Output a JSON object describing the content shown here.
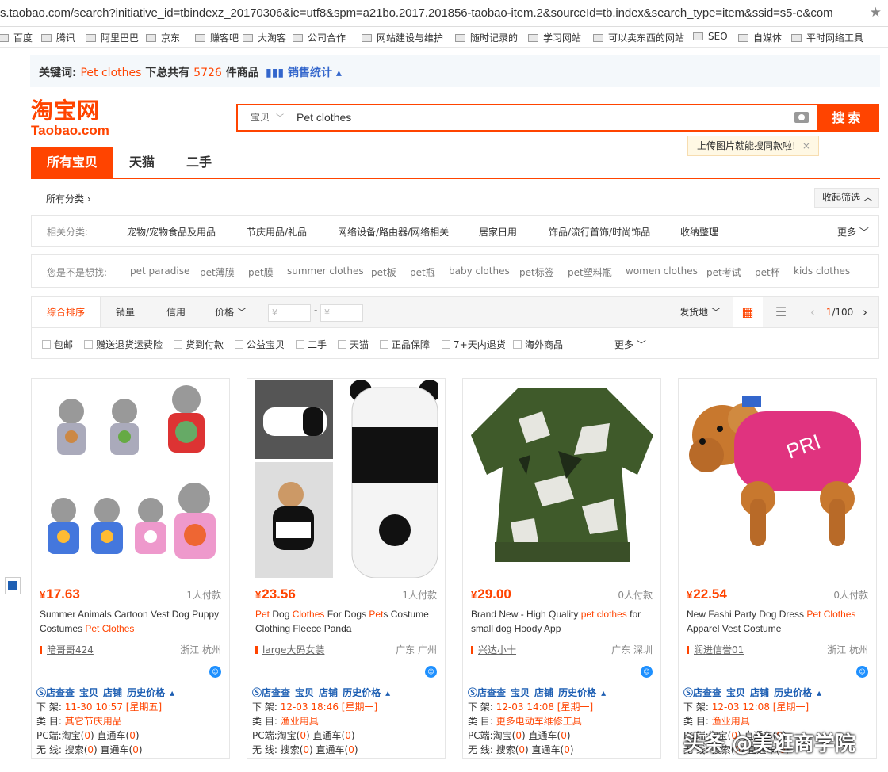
{
  "browser": {
    "url": "s.taobao.com/search?initiative_id=tbindexz_20170306&ie=utf8&spm=a21bo.2017.201856-taobao-item.2&sourceId=tb.index&search_type=item&ssid=s5-e&com",
    "bookmarks": [
      "百度",
      "腾讯",
      "阿里巴巴",
      "京东",
      "赚客吧",
      "大淘客",
      "公司合作",
      "网站建设与维护",
      "随时记录的",
      "学习网站",
      "可以卖东西的网站",
      "SEO",
      "自媒体",
      "平时网络工具"
    ]
  },
  "keyword_bar": {
    "label": "关键词:",
    "keyword": "Pet clothes",
    "mid": "下总共有",
    "count": "5726",
    "suffix": "件商品",
    "sales_stats": "销售统计"
  },
  "logo": {
    "cn": "淘宝网",
    "en": "Taobao.com"
  },
  "search": {
    "category": "宝贝",
    "query": "Pet clothes",
    "button": "搜索",
    "tip": "上传图片就能搜同款啦!"
  },
  "tabs": [
    "所有宝贝",
    "天猫",
    "二手"
  ],
  "all_categories": "所有分类",
  "collapse_filter": "收起筛选",
  "related": {
    "label": "相关分类:",
    "items": [
      "宠物/宠物食品及用品",
      "节庆用品/礼品",
      "网络设备/路由器/网络相关",
      "居家日用",
      "饰品/流行首饰/时尚饰品",
      "收纳整理"
    ],
    "more": "更多"
  },
  "suggest": {
    "label": "您是不是想找:",
    "items": [
      "pet paradise",
      "pet薄膜",
      "pet膜",
      "summer clothes",
      "pet板",
      "pet瓶",
      "baby clothes",
      "pet标签",
      "pet塑料瓶",
      "women clothes",
      "pet考试",
      "pet杯",
      "kids clothes"
    ]
  },
  "sort": {
    "tabs": [
      "综合排序",
      "销量",
      "信用",
      "价格"
    ],
    "price_from": "¥",
    "price_to": "¥",
    "ship_from": "发货地",
    "page": "1",
    "total": "/100"
  },
  "filters": [
    "包邮",
    "赠送退货运费险",
    "货到付款",
    "公益宝贝",
    "二手",
    "天猫",
    "正品保障",
    "7+天内退货",
    "海外商品"
  ],
  "filters_more": "更多",
  "products": [
    {
      "price": "17.63",
      "deals": "1人付款",
      "title_parts": [
        [
          "Summer Animals Cartoon Vest Dog Puppy Costumes ",
          false
        ],
        [
          "Pet Clothes",
          true
        ]
      ],
      "shop": "暗哥哥424",
      "loc": "浙江 杭州",
      "delist_time": "11-30 10:57 [星期五]",
      "category": "其它节庆用品"
    },
    {
      "price": "23.56",
      "deals": "1人付款",
      "title_parts": [
        [
          "Pet",
          true
        ],
        [
          " Dog ",
          false
        ],
        [
          "Clothes",
          true
        ],
        [
          " For Dogs ",
          false
        ],
        [
          "Pet",
          true
        ],
        [
          "s Costume Clothing Fleece Panda",
          false
        ]
      ],
      "shop": "large大码女装",
      "loc": "广东 广州",
      "delist_time": "12-03 18:46 [星期一]",
      "category": "渔业用具"
    },
    {
      "price": "29.00",
      "deals": "0人付款",
      "title_parts": [
        [
          "Brand New - High Quality ",
          false
        ],
        [
          "pet clothes",
          true
        ],
        [
          " for small dog Hoody App",
          false
        ]
      ],
      "shop": "兴达小十",
      "loc": "广东 深圳",
      "delist_time": "12-03 14:08 [星期一]",
      "category": "更多电动车维修工具"
    },
    {
      "price": "22.54",
      "deals": "0人付款",
      "title_parts": [
        [
          "New Fashi Party Dog Dress ",
          false
        ],
        [
          "Pet Clothes",
          true
        ],
        [
          " Apparel Vest Costume",
          false
        ]
      ],
      "shop": "润进信誉01",
      "loc": "浙江 杭州",
      "delist_time": "12-03 12:08 [星期一]",
      "category": "渔业用具"
    }
  ],
  "card_labels": {
    "tools": [
      "店查查",
      "宝贝",
      "店铺",
      "历史价格"
    ],
    "delist": "下 架:",
    "category": "类 目:",
    "pc_label": "PC端:",
    "wireless_label": "无 线:",
    "taobao": "淘宝(",
    "search": "搜索(",
    "through": ") 直通车(",
    "zero": "0",
    "close": ")"
  },
  "watermark": "头条 @美逛商学院",
  "colors": {
    "accent": "#ff4400",
    "link": "#1e5fb3"
  }
}
